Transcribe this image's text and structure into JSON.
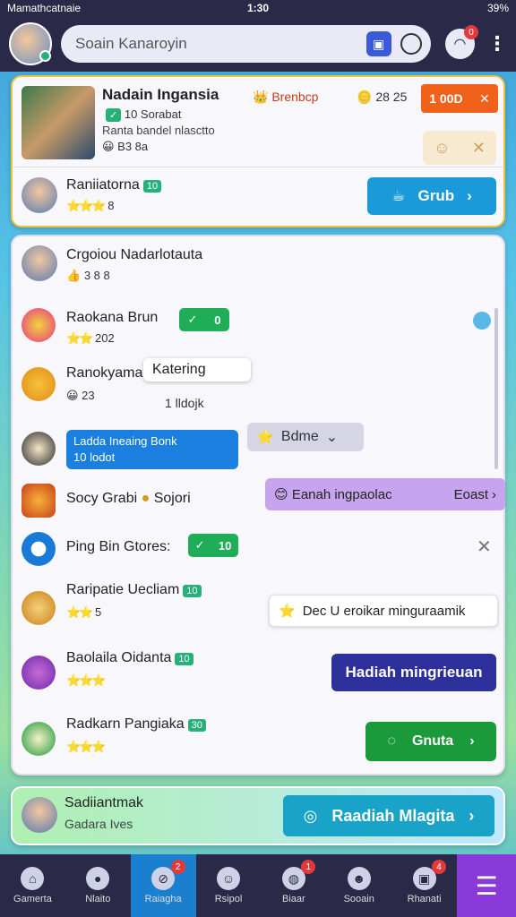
{
  "status_bar": {
    "carrier": "Mamathcatnaie",
    "time": "1:30",
    "battery": "39%"
  },
  "top_bar": {
    "search_text": "Soain Kanaroyin",
    "notif_count": "0"
  },
  "card1": {
    "name": "Nadain Ingansia",
    "line2": "10 Sorabat",
    "line3": "Ranta bandel nlasctto",
    "line4": "B3 8a",
    "outline_label": "Brenbcp",
    "coins": "28 25",
    "orange_btn": "1 00D",
    "row2_name": "Raniiatorna",
    "row2_level": "10",
    "row2_meta": "8",
    "blue_btn": "Grub"
  },
  "card2": {
    "header_name": "Crgoiou Nadarlotauta",
    "header_meta": "3 8 8",
    "rows": [
      {
        "name": "Raokana Brun",
        "sub": "202",
        "pill": "0"
      },
      {
        "name": "Ranokyamac",
        "sub": "23",
        "tooltip_title": "Katering",
        "tooltip_sub": "1 lldojk"
      },
      {
        "bubble_line1": "Ladda Ineaing Bonk",
        "bubble_line2": "10 lodot",
        "grey_chip": "Bdme"
      },
      {
        "name": "Socy Grabi",
        "sub": "Sojori",
        "purple_chip": "Eanah ingpaolac",
        "purple_chip_right": "Eoast"
      },
      {
        "name": "Ping Bin Gtores:",
        "pill": "10"
      },
      {
        "name": "Raripatie Uecliam",
        "level": "10",
        "meta": "5",
        "white_chip": "Dec U eroikar minguraamik"
      },
      {
        "name": "Baolaila Oidanta",
        "level": "10",
        "navy_btn": "Hadiah mingrieuan"
      },
      {
        "name": "Radkarn Pangiaka",
        "level": "30",
        "green_btn": "Gnuta"
      }
    ]
  },
  "card3": {
    "name": "Sadiiantmak",
    "sub": "Gadara Ives",
    "btn": "Raadiah Mlagita"
  },
  "bottom_nav": {
    "items": [
      {
        "label": "Gamerta",
        "badge": ""
      },
      {
        "label": "Nlaito",
        "badge": ""
      },
      {
        "label": "Raiagha",
        "badge": "2"
      },
      {
        "label": "Rsipol",
        "badge": ""
      },
      {
        "label": "Biaar",
        "badge": "1"
      },
      {
        "label": "Sooain",
        "badge": ""
      },
      {
        "label": "Rhanati",
        "badge": "4"
      }
    ]
  },
  "colors": {
    "topbar": "#2a2a48",
    "accent_blue": "#1a9ad8",
    "accent_orange": "#f0621a",
    "accent_green": "#1fae57",
    "accent_purple": "#8a3ad8"
  }
}
